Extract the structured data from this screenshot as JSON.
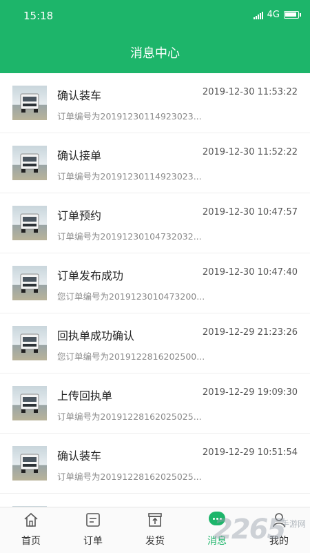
{
  "status_bar": {
    "time": "15:18",
    "network": "4G"
  },
  "header": {
    "title": "消息中心"
  },
  "messages": [
    {
      "title": "确认装车",
      "time": "2019-12-30 11:53:22",
      "subtitle": "订单编号为20191230114923023..."
    },
    {
      "title": "确认接单",
      "time": "2019-12-30 11:52:22",
      "subtitle": "订单编号为20191230114923023..."
    },
    {
      "title": "订单预约",
      "time": "2019-12-30 10:47:57",
      "subtitle": "订单编号为20191230104732032..."
    },
    {
      "title": "订单发布成功",
      "time": "2019-12-30 10:47:40",
      "subtitle": "您订单编号为2019123010473200..."
    },
    {
      "title": "回执单成功确认",
      "time": "2019-12-29 21:23:26",
      "subtitle": "您订单编号为2019122816202500..."
    },
    {
      "title": "上传回执单",
      "time": "2019-12-29 19:09:30",
      "subtitle": "订单编号为20191228162025025..."
    },
    {
      "title": "确认装车",
      "time": "2019-12-29 10:51:54",
      "subtitle": "订单编号为20191228162025025..."
    }
  ],
  "tabbar": {
    "tabs": [
      {
        "label": "首页",
        "icon": "home-icon"
      },
      {
        "label": "订单",
        "icon": "order-icon"
      },
      {
        "label": "发货",
        "icon": "ship-icon"
      },
      {
        "label": "消息",
        "icon": "message-icon"
      },
      {
        "label": "我的",
        "icon": "profile-icon"
      }
    ],
    "active_index": 3
  },
  "watermark": {
    "big": "2265",
    "small": "手游网"
  },
  "colors": {
    "primary": "#1db56a"
  }
}
